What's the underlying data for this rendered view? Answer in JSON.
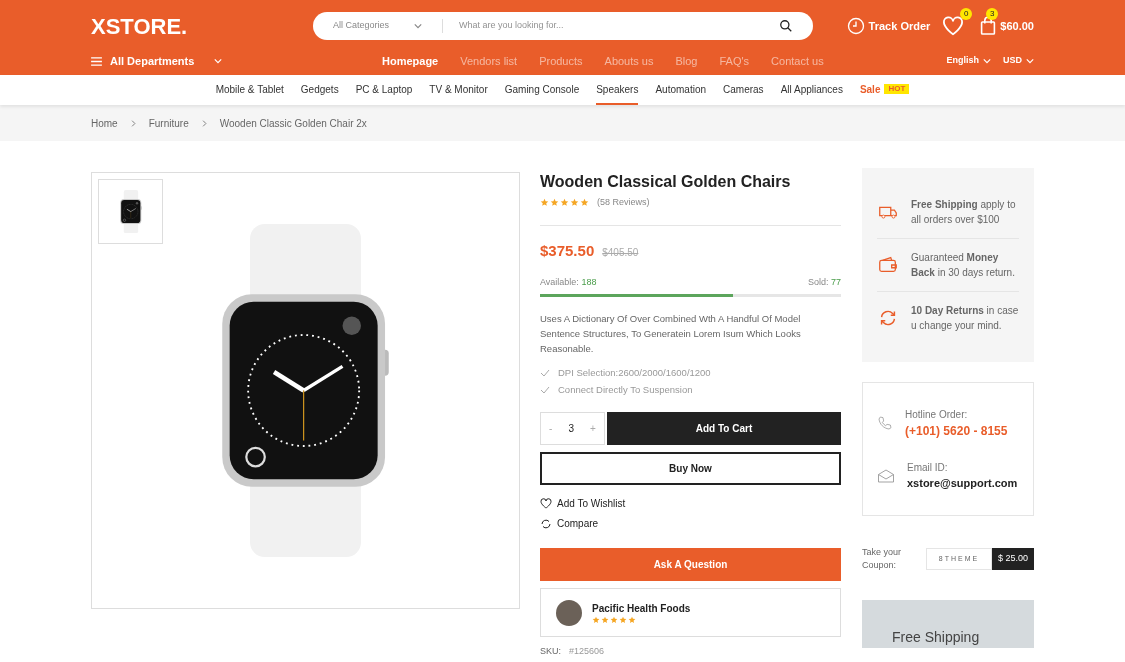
{
  "header": {
    "logo": "XSTORE.",
    "search": {
      "category": "All Categories",
      "placeholder": "What are you looking for..."
    },
    "track_order": "Track Order",
    "wishlist_count": "0",
    "cart_count": "3",
    "cart_total": "$60.00"
  },
  "departments": "All Departments",
  "main_nav": [
    {
      "label": "Homepage",
      "selected": true
    },
    {
      "label": "Vendors list",
      "selected": false
    },
    {
      "label": "Products",
      "selected": false
    },
    {
      "label": "Abouts us",
      "selected": false
    },
    {
      "label": "Blog",
      "selected": false
    },
    {
      "label": "FAQ's",
      "selected": false
    },
    {
      "label": "Contact us",
      "selected": false
    }
  ],
  "language": "English",
  "currency": "USD",
  "categories": [
    {
      "label": "Mobile & Tablet",
      "selected": false
    },
    {
      "label": "Gedgets",
      "selected": false
    },
    {
      "label": "PC & Laptop",
      "selected": false
    },
    {
      "label": "TV & Monitor",
      "selected": false
    },
    {
      "label": "Gaming Console",
      "selected": false
    },
    {
      "label": "Speakers",
      "selected": true
    },
    {
      "label": "Automation",
      "selected": false
    },
    {
      "label": "Cameras",
      "selected": false
    },
    {
      "label": "All Appliances",
      "selected": false
    },
    {
      "label": "Sale",
      "selected": false,
      "kind": "sale",
      "badge": "HOT"
    }
  ],
  "breadcrumb": [
    "Home",
    "Furniture",
    "Wooden Classic Golden Chair 2x"
  ],
  "product": {
    "title": "Wooden Classical Golden Chairs",
    "stars": 5,
    "reviews": "(58 Reviews)",
    "price": "$375.50",
    "old_price": "$405.50",
    "available_label": "Available:",
    "available": "188",
    "sold_label": "Sold:",
    "sold": "77",
    "level": 0.64,
    "description": "Uses A Dictionary Of Over Combined Wth A Handful Of Model Sentence Structures, To Generatein Lorem Isum Which Looks Reasonable.",
    "features": [
      "DPI Selection:2600/2000/1600/1200",
      "Connect Directly To Suspension"
    ],
    "quantity": "3",
    "minus": "-",
    "plus": "+",
    "add_to_cart": "Add To Cart",
    "buy_now": "Buy Now",
    "wishlist": "Add To Wishlist",
    "compare": "Compare",
    "ask": "Ask A Question",
    "seller": {
      "name": "Pacific Health Foods",
      "stars": 5
    },
    "sku_label": "SKU:",
    "sku": "#125606"
  },
  "services": [
    {
      "kind": "truck",
      "text": "**Free Shipping** apply to all orders over $100"
    },
    {
      "kind": "wallet",
      "text": "Guaranteed **Money Back** in 30 days return."
    },
    {
      "kind": "refresh",
      "text": "**10 Day Returns** in case u change your mind."
    }
  ],
  "contact": [
    {
      "kind": "phone",
      "label": "Hotline Order:",
      "value": "(+101) 5620 - 8155"
    },
    {
      "kind": "email",
      "label": "Email ID:",
      "value": "xstore@support.com"
    }
  ],
  "coupon": {
    "label": "Take your Coupon:",
    "code": "8THEME",
    "amount": "$ 25.00"
  },
  "banner": {
    "title": "Free Shipping"
  }
}
